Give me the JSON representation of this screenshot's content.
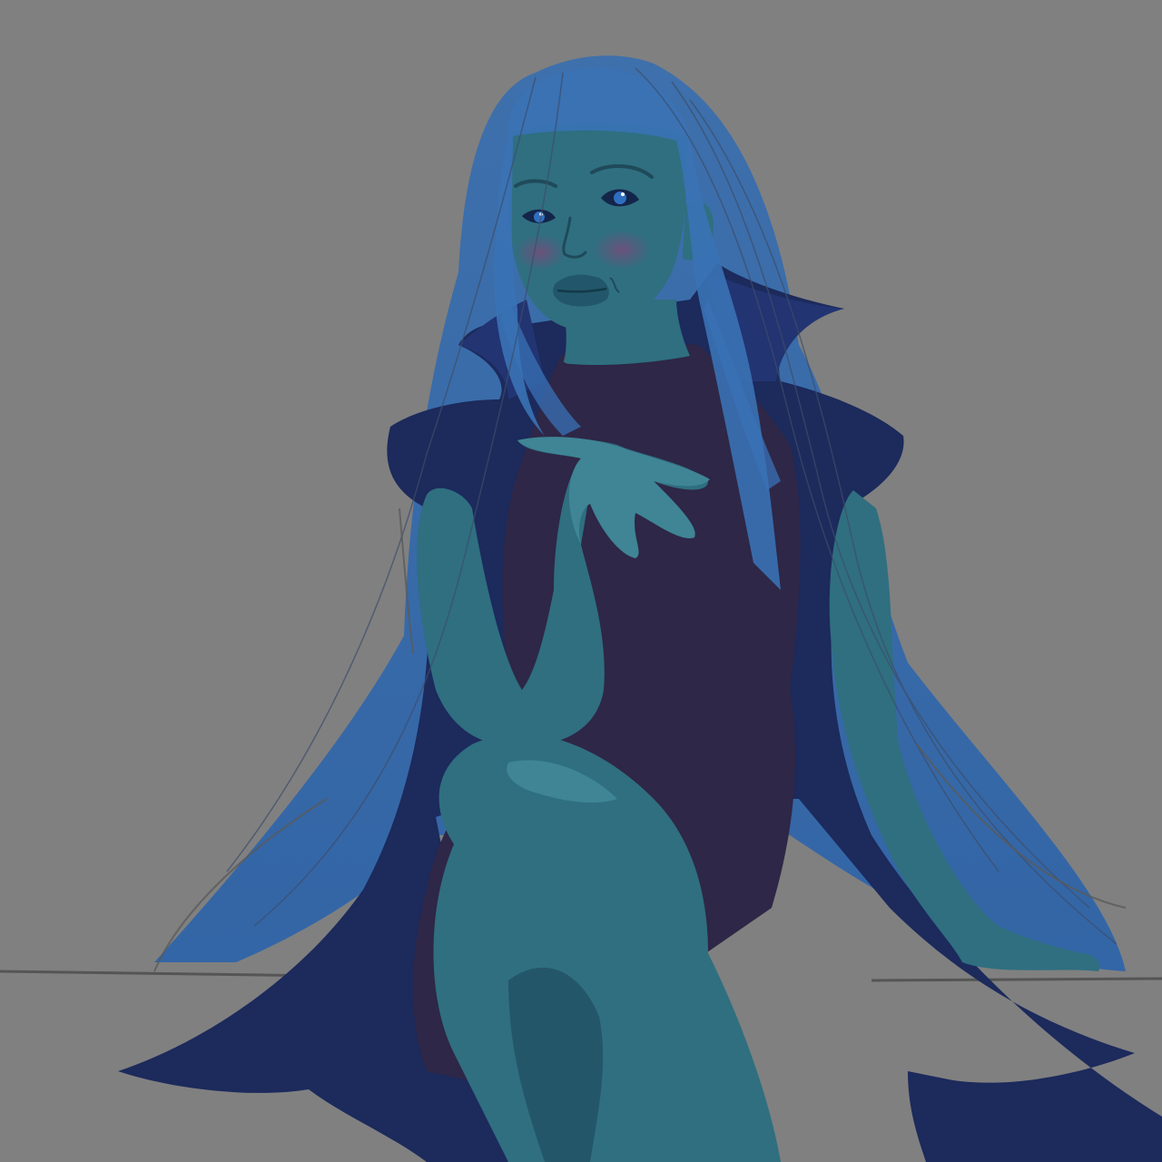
{
  "artwork": {
    "subject": "blue-skinned-character",
    "colors": {
      "background": "#808080",
      "hair": "#2f5f9a",
      "hair_light": "#3f78b8",
      "skin": "#2f6f80",
      "skin_light": "#3f8595",
      "skin_dark": "#24566a",
      "dress": "#2e2747",
      "cape": "#1c2a5c",
      "sketch_line": "#555555"
    }
  }
}
